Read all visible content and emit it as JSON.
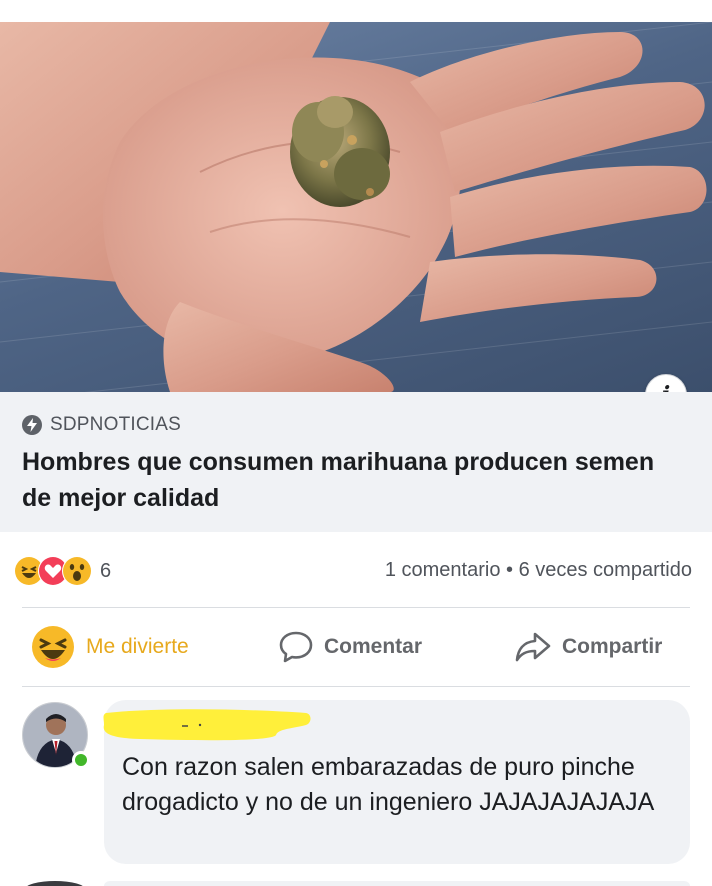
{
  "link_preview": {
    "source": "SDPNOTICIAS",
    "headline": "Hombres que consumen marihuana producen semen de mejor calidad",
    "info_glyph": "i"
  },
  "engagement": {
    "reaction_icons": [
      "haha-icon",
      "love-icon",
      "wow-icon"
    ],
    "reaction_count": "6",
    "stats": "1 comentario • 6 veces compartido"
  },
  "actions": {
    "react_label": "Me divierte",
    "comment_label": "Comentar",
    "share_label": "Compartir"
  },
  "comment": {
    "text": "Con razon salen embarazadas de puro pinche drogadicto y no de un ingeniero JAJAJAJAJAJA"
  },
  "colors": {
    "reaction_active": "#f7b928",
    "online": "#42b72a",
    "bubble": "#f0f2f5",
    "redaction_marker": "#ffef3a"
  }
}
